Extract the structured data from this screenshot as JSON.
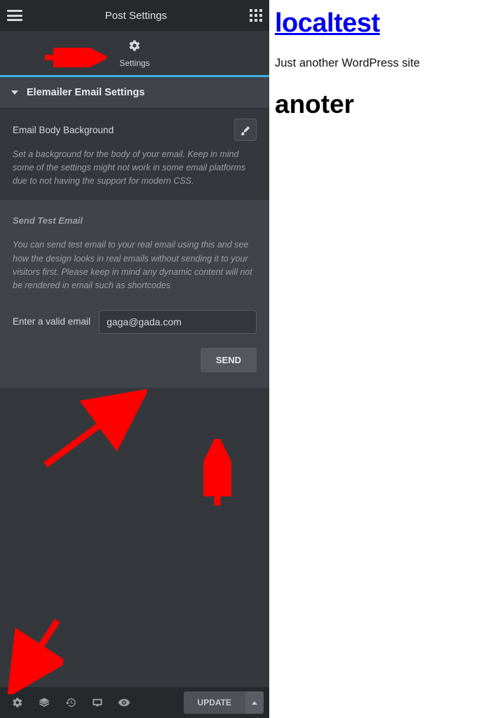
{
  "header": {
    "title": "Post Settings"
  },
  "settingsTab": {
    "label": "Settings"
  },
  "section": {
    "title": "Elemailer Email Settings"
  },
  "bgControl": {
    "label": "Email Body Background",
    "description": "Set a background for the body of your email. Keep in mind some of the settings might not work in some email platforms due to not having the support for modern CSS."
  },
  "sendTest": {
    "title": "Send Test Email",
    "description": "You can send test email to your real email using this and see how the design looks in real emails without sending it to your visitors first. Please keep in mind any dynamic content will not be rendered in email such as shortcodes",
    "inputLabel": "Enter a valid email",
    "inputValue": "gaga@gada.com",
    "sendLabel": "SEND"
  },
  "footer": {
    "updateLabel": "UPDATE"
  },
  "preview": {
    "siteTitle": "localtest",
    "tagline": "Just another WordPress site",
    "postTitle": "anoter"
  }
}
